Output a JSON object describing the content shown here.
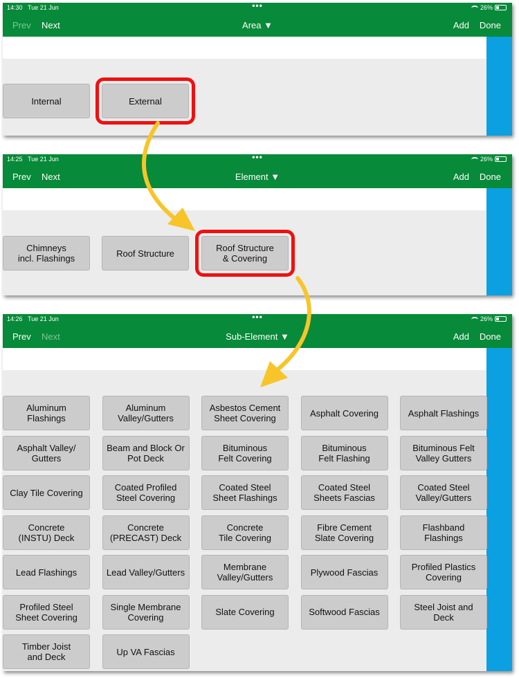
{
  "colors": {
    "header": "#078a39",
    "sidebar": "#0aa0e2",
    "highlight": "#f01010",
    "arrow": "#f7c52a"
  },
  "panels": [
    {
      "status": {
        "time": "14:30",
        "date": "Tue 21 Jun",
        "battery": "26%"
      },
      "nav": {
        "prev": "Prev",
        "next": "Next",
        "title": "Area",
        "add": "Add",
        "done": "Done"
      },
      "buttons": [
        {
          "label": "Internal",
          "highlighted": false
        },
        {
          "label": "External",
          "highlighted": true
        }
      ]
    },
    {
      "status": {
        "time": "14:25",
        "date": "Tue 21 Jun",
        "battery": "26%"
      },
      "nav": {
        "prev": "Prev",
        "next": "Next",
        "title": "Element",
        "add": "Add",
        "done": "Done"
      },
      "buttons": [
        {
          "label": "Chimneys\nincl. Flashings",
          "highlighted": false
        },
        {
          "label": "Roof Structure",
          "highlighted": false
        },
        {
          "label": "Roof Structure\n& Covering",
          "highlighted": true
        }
      ]
    },
    {
      "status": {
        "time": "14:26",
        "date": "Tue 21 Jun",
        "battery": "26%"
      },
      "nav": {
        "prev": "Prev",
        "next": "Next",
        "title": "Sub-Element",
        "add": "Add",
        "done": "Done",
        "next_disabled": true
      },
      "buttons": [
        "Aluminum Flashings",
        "Aluminum\nValley/Gutters",
        "Asbestos Cement\nSheet Covering",
        "Asphalt Covering",
        "Asphalt Flashings",
        "Asphalt Valley/\nGutters",
        "Beam and Block Or\nPot Deck",
        "Bituminous\nFelt Covering",
        "Bituminous\nFelt Flashing",
        "Bituminous Felt\nValley Gutters",
        "Clay Tile Covering",
        "Coated Profiled\nSteel Covering",
        "Coated Steel\nSheet Flashings",
        "Coated Steel\nSheets Fascias",
        "Coated Steel\nValley/Gutters",
        "Concrete\n(INSTU) Deck",
        "Concrete\n(PRECAST) Deck",
        "Concrete\nTile Covering",
        "Fibre Cement\nSlate Covering",
        "Flashband Flashings",
        "Lead Flashings",
        "Lead Valley/Gutters",
        "Membrane\nValley/Gutters",
        "Plywood Fascias",
        "Profiled Plastics\nCovering",
        "Profiled Steel\nSheet Covering",
        "Single Membrane\nCovering",
        "Slate Covering",
        "Softwood Fascias",
        "Steel Joist and Deck",
        "Timber Joist\nand Deck",
        "Up VA Fascias"
      ]
    }
  ]
}
